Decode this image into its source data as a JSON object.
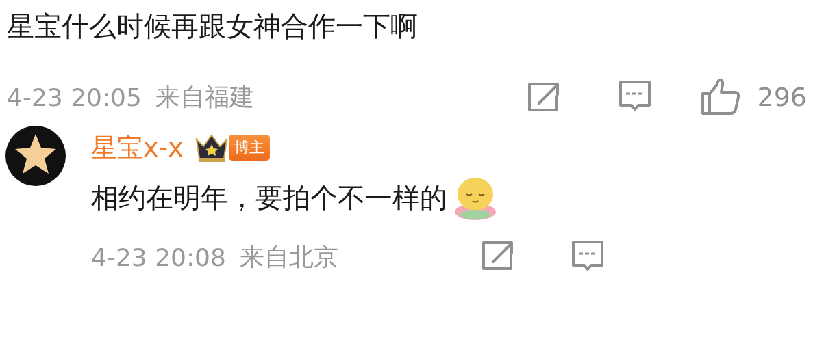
{
  "comments": [
    {
      "kind": "post",
      "text": "星宝什么时候再跟女神合作一下啊",
      "time": "4-23 20:05",
      "location": "来自福建",
      "like_count": "296"
    },
    {
      "kind": "reply",
      "author": "星宝x-x",
      "badge": "博主",
      "text": "相约在明年，要拍个不一样的",
      "time": "4-23 20:08",
      "location": "来自北京"
    }
  ]
}
